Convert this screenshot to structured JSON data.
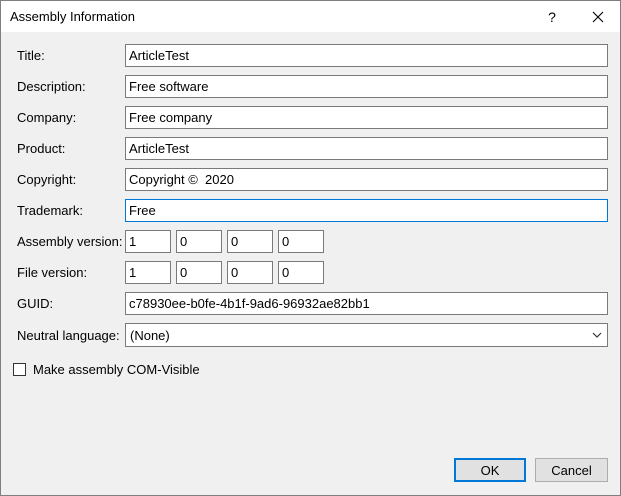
{
  "window": {
    "title": "Assembly Information",
    "help_glyph": "?"
  },
  "fields": {
    "title": {
      "label": "Title:",
      "value": "ArticleTest"
    },
    "description": {
      "label": "Description:",
      "value": "Free software"
    },
    "company": {
      "label": "Company:",
      "value": "Free company"
    },
    "product": {
      "label": "Product:",
      "value": "ArticleTest"
    },
    "copyright": {
      "label": "Copyright:",
      "value": "Copyright ©  2020"
    },
    "trademark": {
      "label": "Trademark:",
      "value": "Free"
    },
    "assembly_version": {
      "label": "Assembly version:",
      "parts": [
        "1",
        "0",
        "0",
        "0"
      ]
    },
    "file_version": {
      "label": "File version:",
      "parts": [
        "1",
        "0",
        "0",
        "0"
      ]
    },
    "guid": {
      "label": "GUID:",
      "value": "c78930ee-b0fe-4b1f-9ad6-96932ae82bb1"
    },
    "neutral_language": {
      "label": "Neutral language:",
      "value": "(None)"
    }
  },
  "com_visible": {
    "label": "Make assembly COM-Visible",
    "checked": false
  },
  "buttons": {
    "ok": "OK",
    "cancel": "Cancel"
  },
  "colors": {
    "focus_border": "#0078d7",
    "dialog_bg": "#f0f0f0"
  }
}
